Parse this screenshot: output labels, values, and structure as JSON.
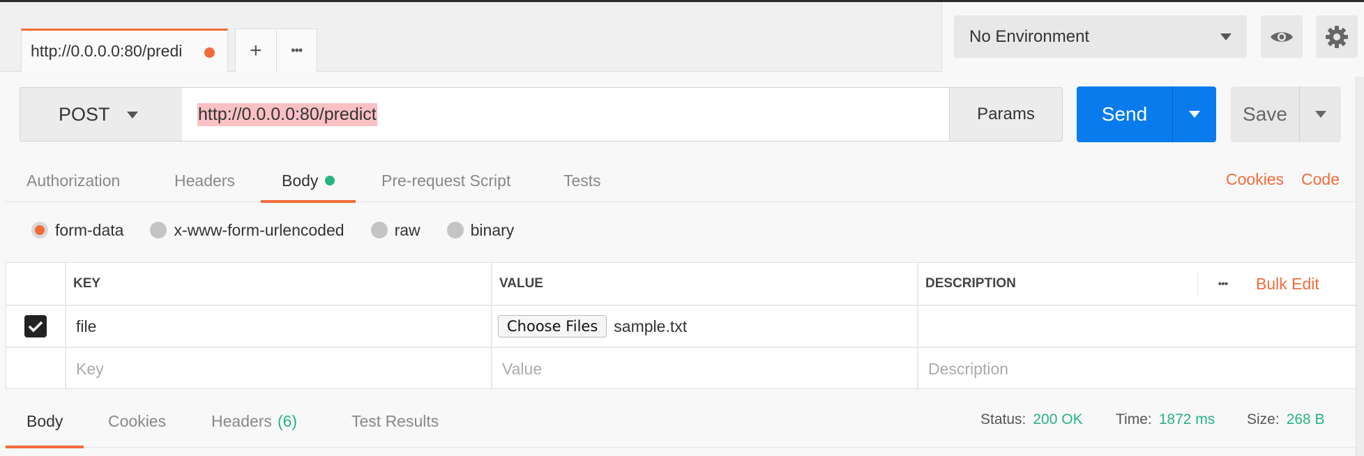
{
  "tabs": {
    "active_tab_title": "http://0.0.0.0:80/predi",
    "add_tab_symbol": "+",
    "more_symbol": "•••"
  },
  "environment": {
    "selected": "No Environment",
    "icons": [
      "eye-icon",
      "gear-icon"
    ]
  },
  "request": {
    "method": "POST",
    "url": "http://0.0.0.0:80/predict",
    "params_label": "Params",
    "send_label": "Send",
    "save_label": "Save"
  },
  "request_tabs": {
    "items": [
      "Authorization",
      "Headers",
      "Body",
      "Pre-request Script",
      "Tests"
    ],
    "active": "Body",
    "cookies_link": "Cookies",
    "code_link": "Code"
  },
  "body_modes": {
    "options": [
      "form-data",
      "x-www-form-urlencoded",
      "raw",
      "binary"
    ],
    "selected": "form-data"
  },
  "table": {
    "headers": {
      "key": "KEY",
      "value": "VALUE",
      "description": "DESCRIPTION"
    },
    "more_symbol": "•••",
    "bulk_edit_label": "Bulk Edit",
    "rows": [
      {
        "checked": true,
        "key": "file",
        "value_button": "Choose Files",
        "value_file": "sample.txt",
        "description": ""
      }
    ],
    "placeholders": {
      "key": "Key",
      "value": "Value",
      "description": "Description"
    }
  },
  "response": {
    "tabs": [
      "Body",
      "Cookies",
      "Headers",
      "Test Results"
    ],
    "headers_count": "(6)",
    "active": "Body",
    "status_label": "Status:",
    "status_value": "200 OK",
    "time_label": "Time:",
    "time_value": "1872 ms",
    "size_label": "Size:",
    "size_value": "268 B"
  },
  "colors": {
    "accent_orange": "#f26b3a",
    "send_blue": "#097bed",
    "success_green": "#26b47f"
  }
}
